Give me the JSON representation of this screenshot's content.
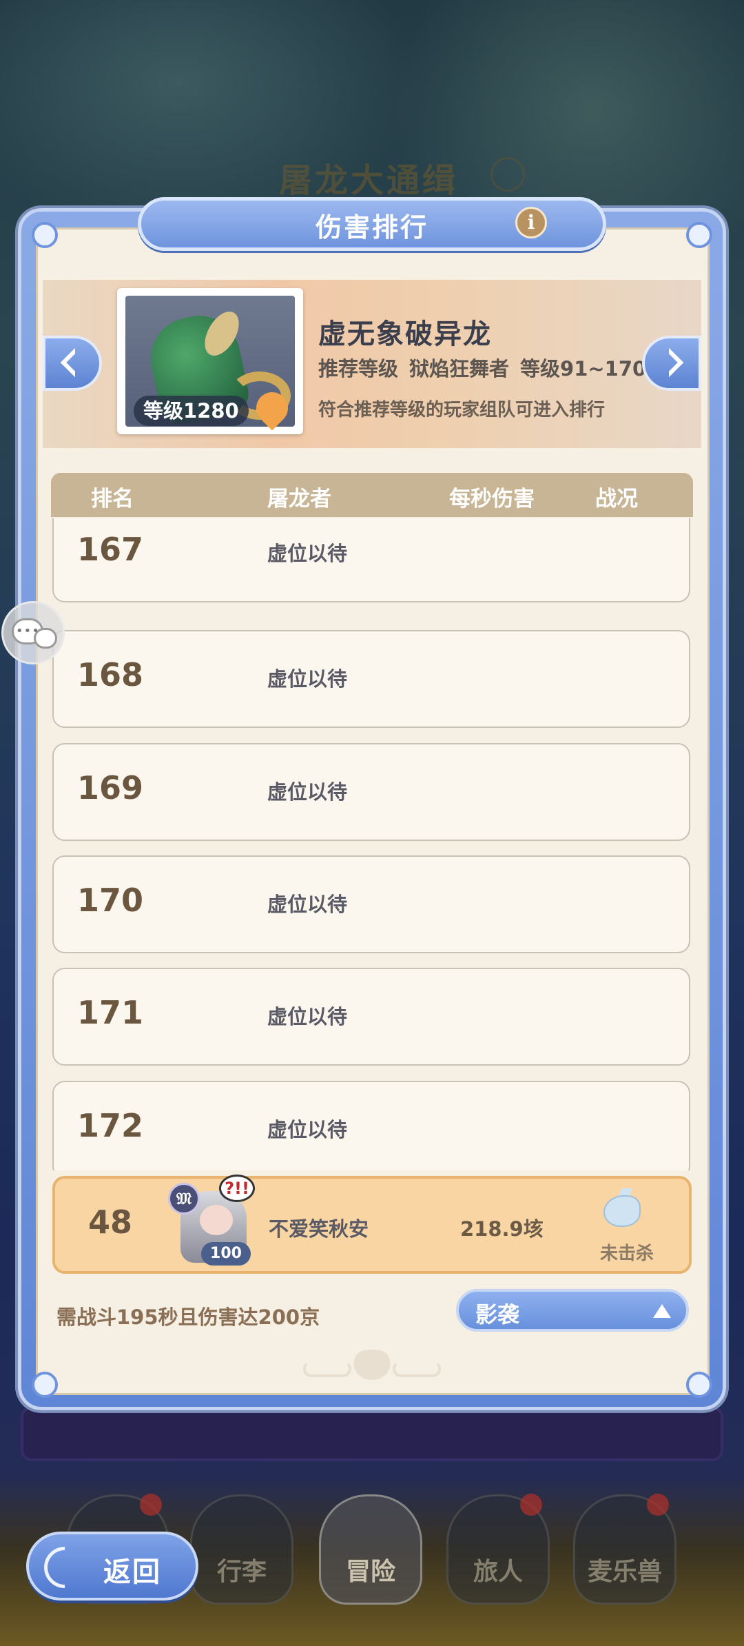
{
  "background": {
    "title": "屠龙大通缉"
  },
  "panel": {
    "title": "伤害排行",
    "info_icon": "i"
  },
  "boss": {
    "name": "虚无象破异龙",
    "level_badge": "等级1280",
    "recommend_label": "推荐等级",
    "recommend_class": "狱焰狂舞者",
    "recommend_range": "等级91~170",
    "note": "符合推荐等级的玩家组队可进入排行"
  },
  "table": {
    "headers": {
      "rank": "排名",
      "slayer": "屠龙者",
      "dps": "每秒伤害",
      "status": "战况"
    },
    "rows": [
      {
        "rank": "167",
        "name": "虚位以待"
      },
      {
        "rank": "168",
        "name": "虚位以待"
      },
      {
        "rank": "169",
        "name": "虚位以待"
      },
      {
        "rank": "170",
        "name": "虚位以待"
      },
      {
        "rank": "171",
        "name": "虚位以待"
      },
      {
        "rank": "172",
        "name": "虚位以待"
      }
    ]
  },
  "my_entry": {
    "rank": "48",
    "avatar_emblem": "𝔐",
    "avatar_shout": "?!!",
    "avatar_level": "100",
    "name": "不爱笑秋安",
    "dps": "218.9垓",
    "status": "未击杀"
  },
  "requirement": "需战斗195秒且伤害达200京",
  "class_select": {
    "value": "影袭"
  },
  "nav": {
    "back": "返回",
    "items": [
      "行李",
      "冒险",
      "旅人",
      "麦乐兽"
    ]
  },
  "colors": {
    "panel_blue": "#6f94dd",
    "panel_bg": "#f6efe3",
    "my_row_bg": "#f9d5a3",
    "header_row": "#c8b595"
  }
}
